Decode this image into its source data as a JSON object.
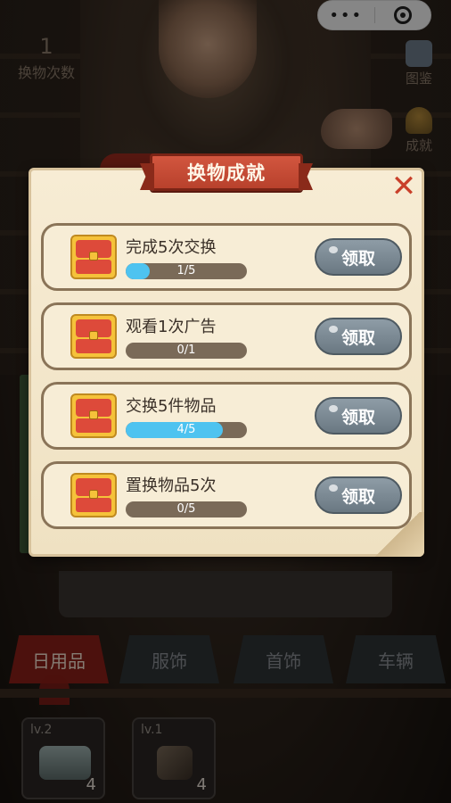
{
  "topbar": {
    "swap_count_value": "1",
    "swap_count_label": "换物次数",
    "album_label": "图鉴",
    "achievement_label": "成就"
  },
  "modal": {
    "title": "换物成就",
    "tasks": [
      {
        "name": "完成5次交换",
        "progress_text": "1/5",
        "progress": 0.2,
        "button": "领取"
      },
      {
        "name": "观看1次广告",
        "progress_text": "0/1",
        "progress": 0.0,
        "button": "领取"
      },
      {
        "name": "交换5件物品",
        "progress_text": "4/5",
        "progress": 0.8,
        "button": "领取"
      },
      {
        "name": "置换物品5次",
        "progress_text": "0/5",
        "progress": 0.0,
        "button": "领取"
      }
    ]
  },
  "tabs": [
    "日用品",
    "服饰",
    "首饰",
    "车辆"
  ],
  "items": [
    {
      "level": "lv.2",
      "qty": "4",
      "icon": "face-mask-icon"
    },
    {
      "level": "lv.1",
      "qty": "4",
      "icon": "cloth-item-icon"
    }
  ],
  "colors": {
    "progress_fill": "#4ec3f0",
    "ribbon": "#c94b35",
    "claim_button": "#7d8b95",
    "active_tab": "#8a1f18"
  }
}
